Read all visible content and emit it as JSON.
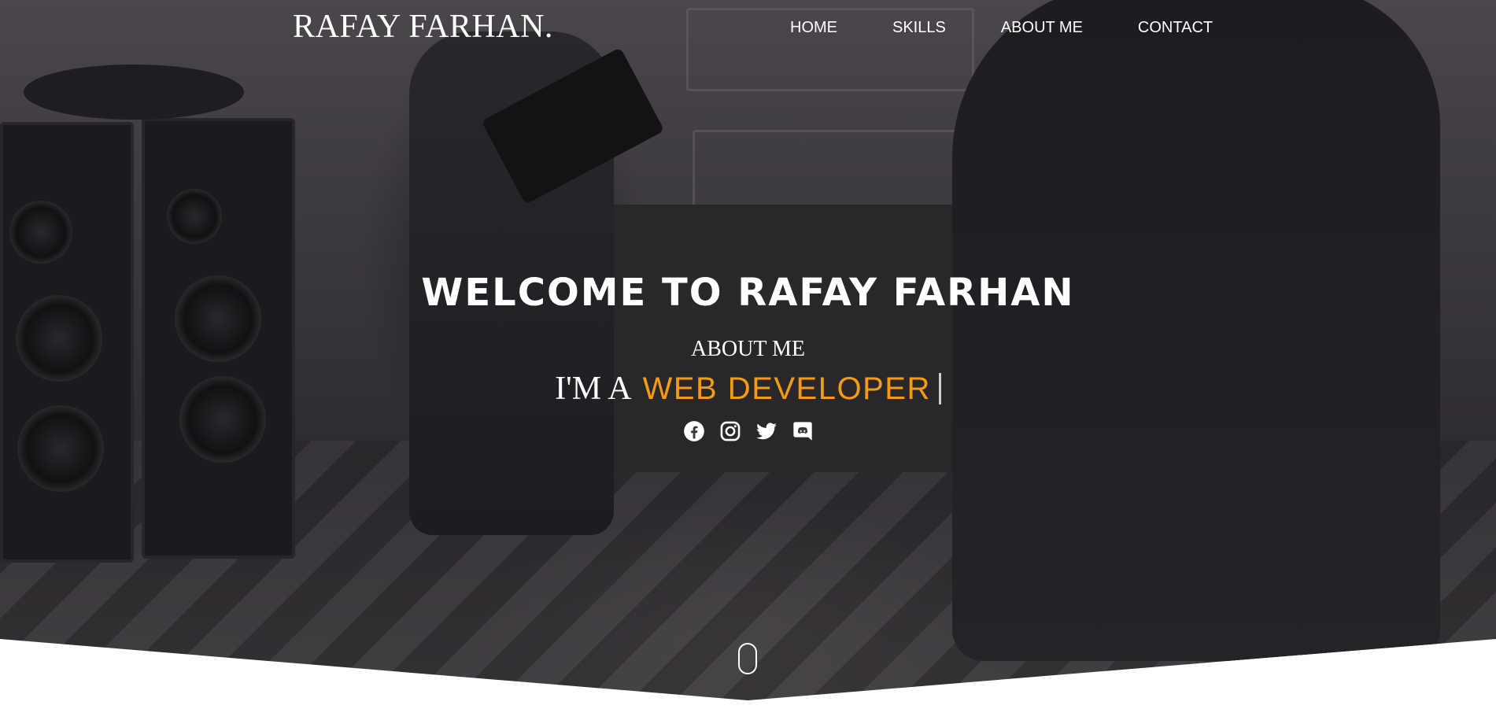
{
  "brand": {
    "name": "RAFAY FARHAN."
  },
  "nav": {
    "items": [
      {
        "label": "HOME"
      },
      {
        "label": "SKILLS"
      },
      {
        "label": "ABOUT ME"
      },
      {
        "label": "CONTACT"
      }
    ]
  },
  "hero": {
    "welcome": "WELCOME TO RAFAY FARHAN",
    "subheading": "ABOUT ME",
    "typed_prefix": "I'M A",
    "typed_role": "WEB DEVELOPER",
    "accent_color": "#f39c12"
  },
  "socials": {
    "icons": [
      "facebook-icon",
      "instagram-icon",
      "twitter-icon",
      "discord-icon"
    ]
  }
}
